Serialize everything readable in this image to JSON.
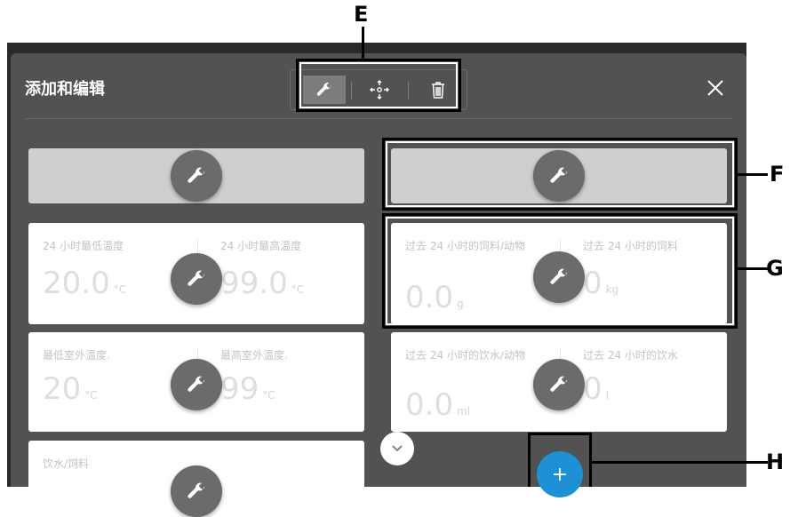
{
  "dialog": {
    "title": "添加和编辑",
    "toolbar": {
      "active_tool": "wrench-icon",
      "tools": [
        "wrench-icon",
        "move-icon",
        "trash-icon"
      ]
    },
    "close_icon": "close-icon"
  },
  "callouts": [
    "E",
    "F",
    "G",
    "H"
  ],
  "cards": [
    {
      "left_label": "24 小时最低温度",
      "left_value": "20.0",
      "left_unit": "°C",
      "right_label": "24 小时最高温度",
      "right_value": "99.0",
      "right_unit": "°C"
    },
    {
      "left_label": "过去 24 小时的饲料/动物",
      "left_value": "0.0",
      "left_unit": "g",
      "right_label": "过去 24 小时的饲料",
      "right_value": "0",
      "right_unit": "kg"
    },
    {
      "left_label": "最低室外温度.",
      "left_value": "20",
      "left_unit": "°C",
      "right_label": "最高室外温度.",
      "right_value": "99",
      "right_unit": "°C"
    },
    {
      "left_label": "过去 24 小时的饮水/动物",
      "left_value": "0.0",
      "left_unit": "ml",
      "right_label": "过去 24 小时的饮水",
      "right_value": "0",
      "right_unit": "l"
    },
    {
      "left_label": "饮水/饲料",
      "left_value": "",
      "left_unit": ""
    }
  ],
  "fab": {
    "add_label": "+",
    "accent_color": "#1e90d6"
  },
  "scroll": {
    "chevron": "chevron-down-icon"
  }
}
